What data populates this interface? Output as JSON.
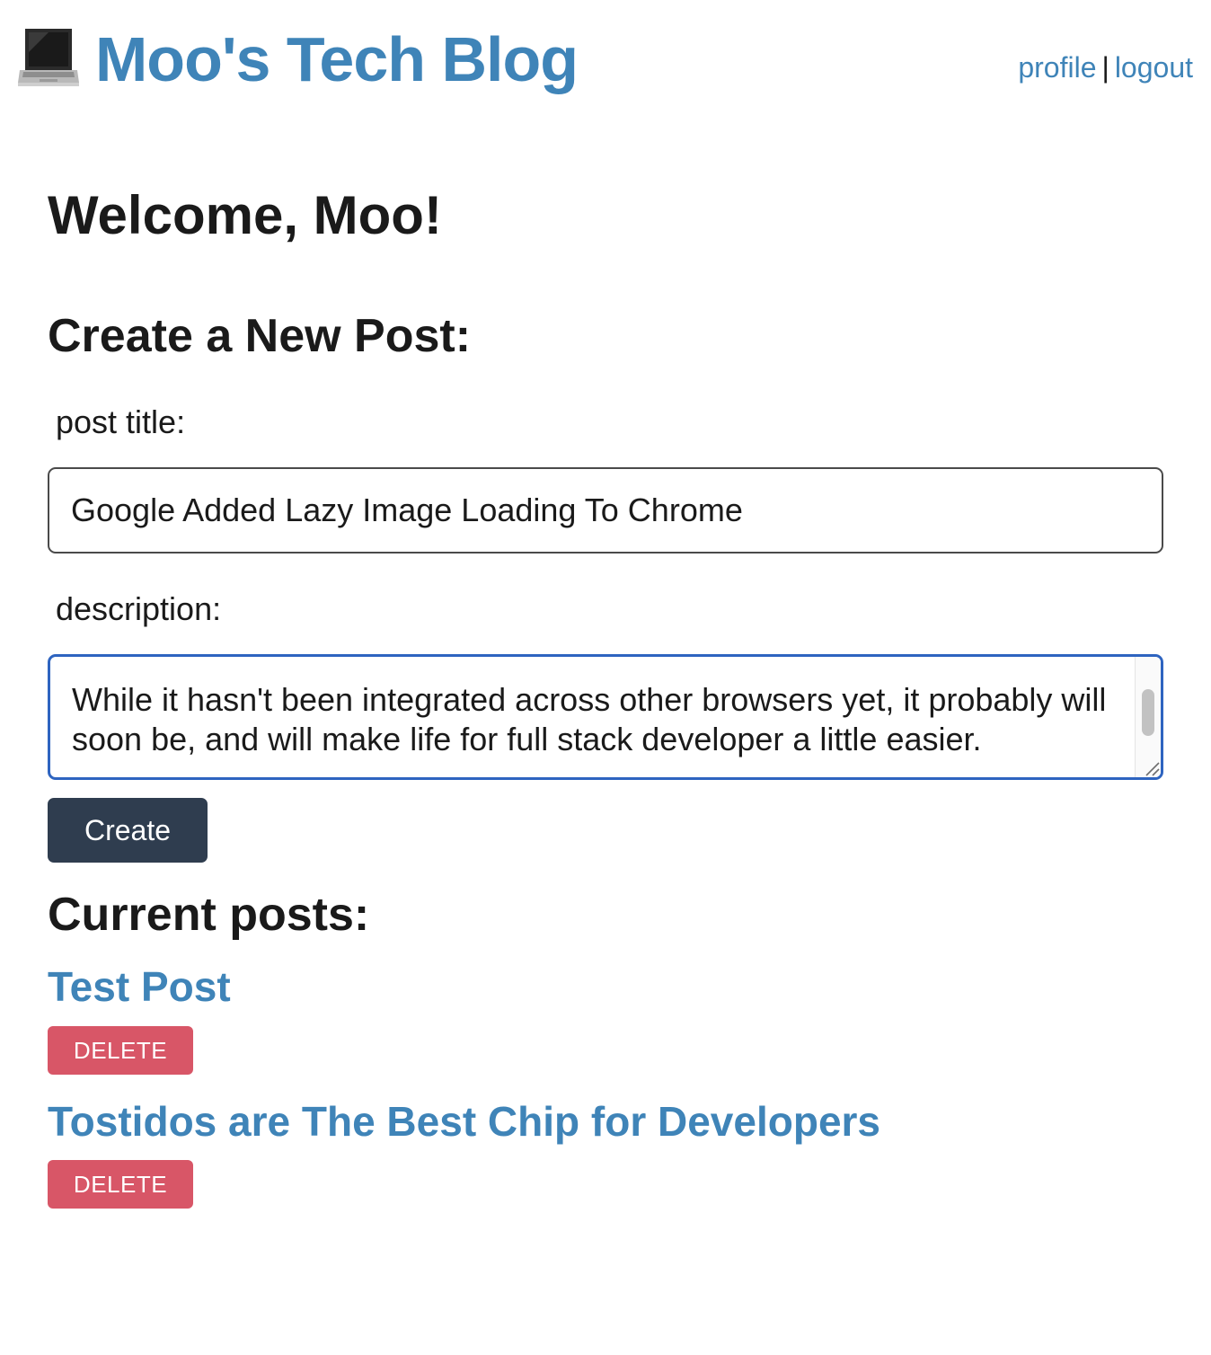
{
  "header": {
    "site_title": "Moo's Tech Blog",
    "logo_icon": "laptop-icon",
    "nav": {
      "profile_label": "profile",
      "separator": "|",
      "logout_label": "logout"
    }
  },
  "main": {
    "welcome": "Welcome, Moo!",
    "create_heading": "Create a New Post:",
    "form": {
      "title_label": "post title:",
      "title_value": "Google Added Lazy Image Loading To Chrome",
      "description_label": "description:",
      "description_value": "While it hasn't been integrated across other browsers yet, it probably will soon be, and will make life for full stack developer a little easier.",
      "create_label": "Create"
    },
    "current_heading": "Current posts:",
    "posts": [
      {
        "title": "Test Post",
        "delete_label": "DELETE"
      },
      {
        "title": "Tostidos are The Best Chip for Developers",
        "delete_label": "DELETE"
      }
    ]
  },
  "colors": {
    "link": "#3f84b8",
    "create_button": "#2f3d4f",
    "delete_button": "#d85667",
    "focus_border": "#2e64c0"
  }
}
